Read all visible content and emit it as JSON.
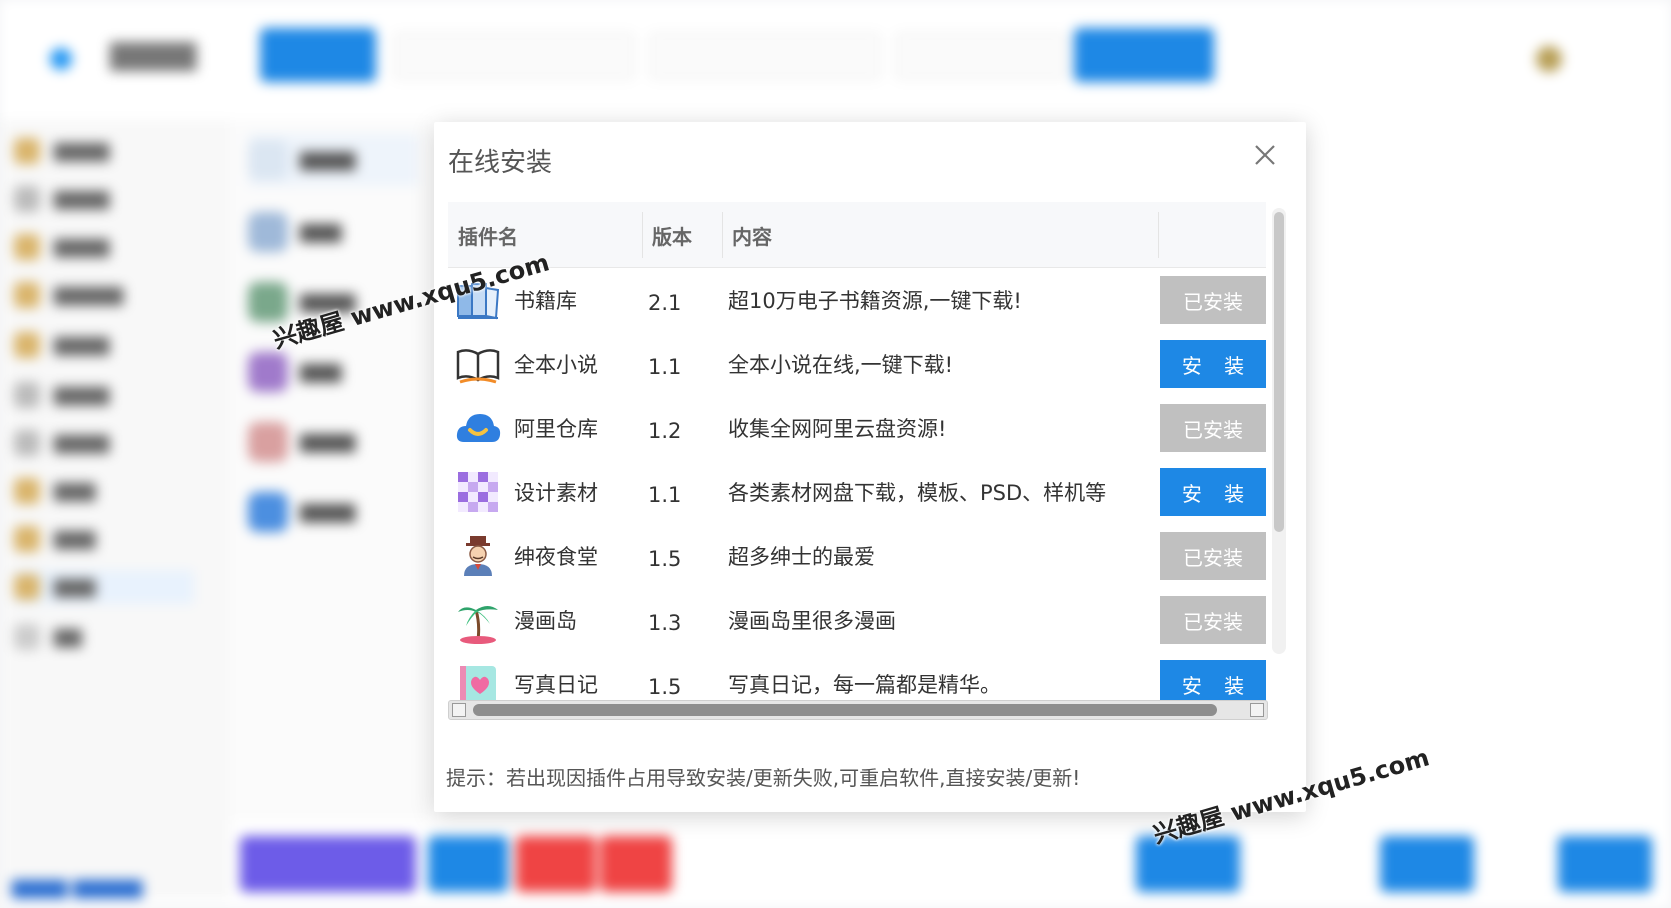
{
  "dialog": {
    "title": "在线安装",
    "columns": [
      "插件名",
      "版本",
      "内容"
    ],
    "plugins": [
      {
        "name": "书籍库",
        "version": "2.1",
        "desc": "超10万电子书籍资源,一键下载!",
        "action": "已安装",
        "status": "installed",
        "icon": "book-shelf-icon"
      },
      {
        "name": "全本小说",
        "version": "1.1",
        "desc": "全本小说在线,一键下载!",
        "action": "安 装",
        "status": "install",
        "icon": "open-book-icon"
      },
      {
        "name": "阿里仓库",
        "version": "1.2",
        "desc": "收集全网阿里云盘资源!",
        "action": "已安装",
        "status": "installed",
        "icon": "cloud-icon"
      },
      {
        "name": "设计素材",
        "version": "1.1",
        "desc": "各类素材网盘下载，模板、PSD、样机等",
        "action": "安 装",
        "status": "install",
        "icon": "checker-pattern-icon"
      },
      {
        "name": "绅夜食堂",
        "version": "1.5",
        "desc": "超多绅士的最爱",
        "action": "已安装",
        "status": "installed",
        "icon": "gentleman-icon"
      },
      {
        "name": "漫画岛",
        "version": "1.3",
        "desc": "漫画岛里很多漫画",
        "action": "已安装",
        "status": "installed",
        "icon": "palm-island-icon"
      },
      {
        "name": "写真日记",
        "version": "1.5",
        "desc": "写真日记，每一篇都是精华。",
        "action": "安 装",
        "status": "install",
        "icon": "heart-diary-icon"
      }
    ],
    "hint": "提示：若出现因插件占用导致安装/更新失败,可重启软件,直接安装/更新!"
  },
  "watermark": "兴趣屋 www.xqu5.com",
  "colors": {
    "accent": "#1e88e5",
    "installed": "#c0c0c0",
    "danger": "#ef4444",
    "purple": "#6d5ce8"
  }
}
